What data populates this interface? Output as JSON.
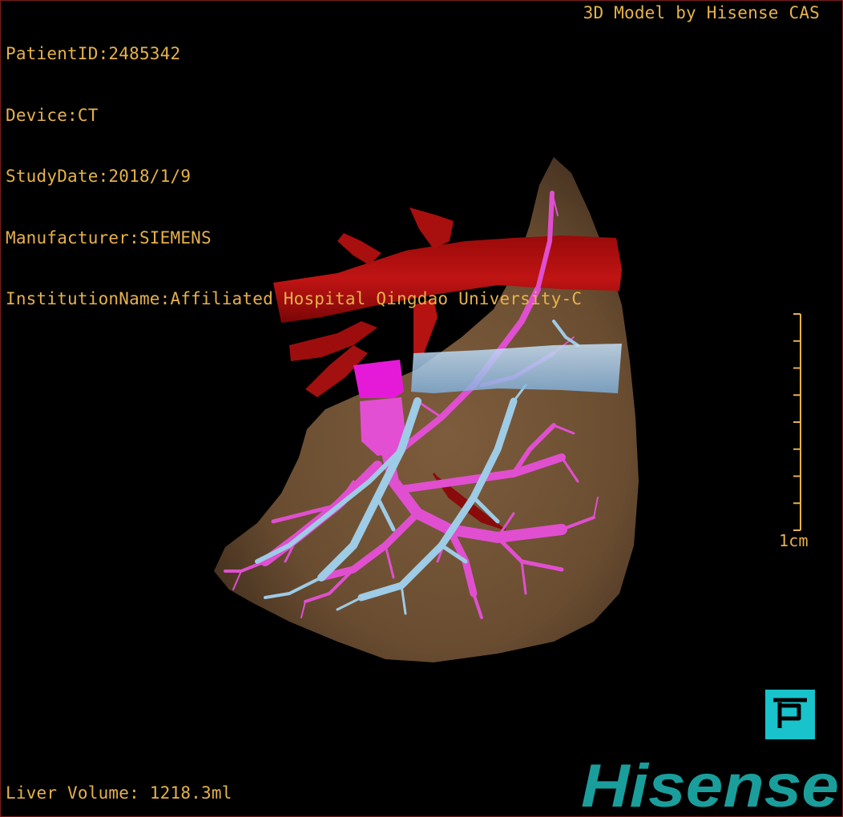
{
  "info": {
    "patient_id": "PatientID:2485342",
    "device": "Device:CT",
    "study_date": "StudyDate:2018/1/9",
    "manufacturer": "Manufacturer:SIEMENS",
    "institution": "InstitutionName:Affiliated Hospital Qingdao University-C"
  },
  "header": {
    "credit": "3D Model by Hisense CAS"
  },
  "footer": {
    "liver_volume": "Liver Volume: 1218.3ml"
  },
  "scale": {
    "label": "1cm",
    "tick_count": 9
  },
  "logo": {
    "text": "Hisense"
  },
  "colors": {
    "overlay_text": "#e6b24a",
    "liver": "#7a5a3a",
    "artery": "#b50d0d",
    "portal_vein": "#e04fd0",
    "hepatic_vein": "#9ecbe6",
    "vena_cava": "#a9cdf0",
    "p_button": "#19c3cc",
    "brand": "#1a9e9c"
  },
  "icons": {
    "p_button": "pan-p-icon"
  }
}
